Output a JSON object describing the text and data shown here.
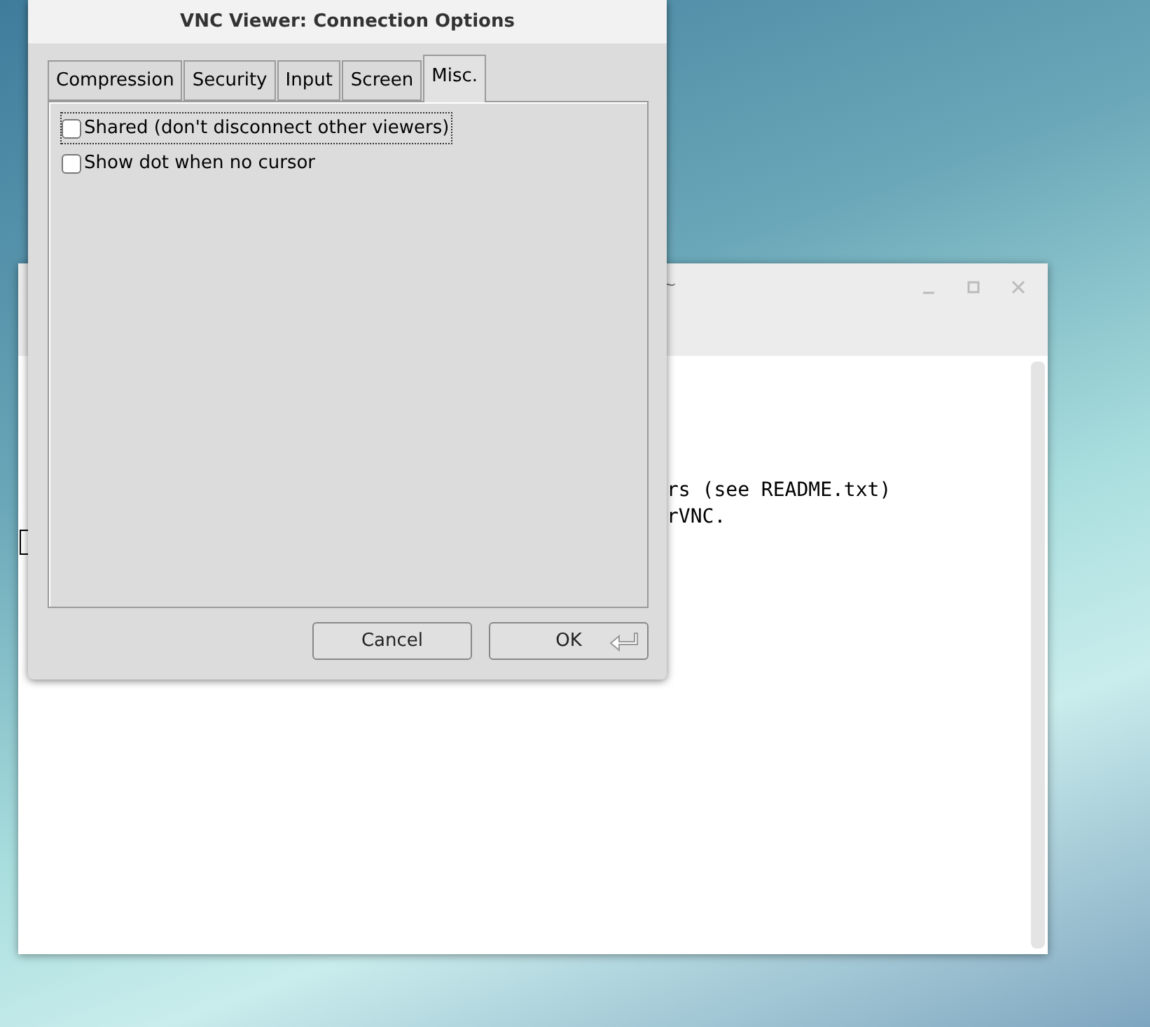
{
  "terminal": {
    "title": "~",
    "rows": [
      {
        "right": "rs (see README.txt)"
      },
      {
        "right": "rVNC."
      }
    ],
    "cursor": true
  },
  "dialog": {
    "title": "VNC Viewer: Connection Options",
    "tabs": [
      {
        "label": "Compression",
        "selected": false
      },
      {
        "label": "Security",
        "selected": false
      },
      {
        "label": "Input",
        "selected": false
      },
      {
        "label": "Screen",
        "selected": false
      },
      {
        "label": "Misc.",
        "selected": true
      }
    ],
    "options": [
      {
        "label": "Shared (don't disconnect other viewers)",
        "checked": false,
        "focused": true
      },
      {
        "label": "Show dot when no cursor",
        "checked": false,
        "focused": false
      }
    ],
    "buttons": [
      {
        "label": "Cancel",
        "default": false
      },
      {
        "label": "OK",
        "default": true
      }
    ]
  }
}
